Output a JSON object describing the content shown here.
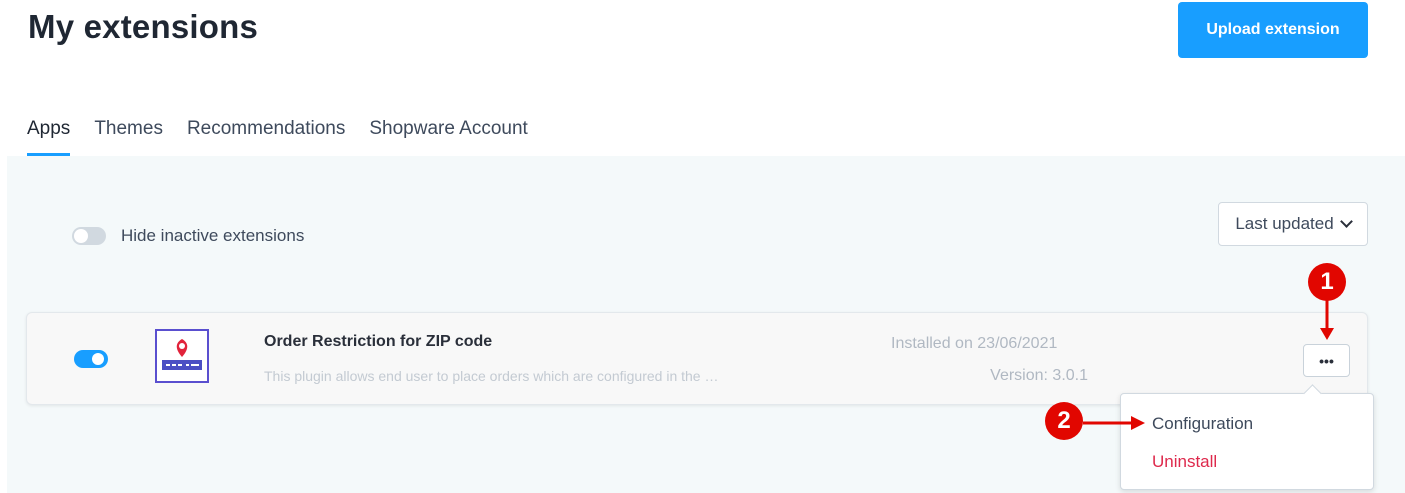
{
  "header": {
    "title": "My extensions",
    "upload_label": "Upload extension"
  },
  "tabs": [
    {
      "label": "Apps",
      "active": true
    },
    {
      "label": "Themes"
    },
    {
      "label": "Recommendations"
    },
    {
      "label": "Shopware Account"
    }
  ],
  "filters": {
    "hide_inactive_label": "Hide inactive extensions",
    "hide_inactive_on": false,
    "sort_label": "Last updated"
  },
  "extension": {
    "name": "Order Restriction for ZIP code",
    "description": "This plugin allows end user to place orders which are configured in the …",
    "installed": "Installed on 23/06/2021",
    "version": "Version: 3.0.1",
    "active": true,
    "more_label": "•••"
  },
  "context_menu": {
    "configuration": "Configuration",
    "uninstall": "Uninstall"
  },
  "annotations": {
    "marker_1": "1",
    "marker_2": "2"
  },
  "colors": {
    "accent": "#189eff",
    "danger": "#de294c",
    "annotation_red": "#e10600",
    "content_bg": "#f4f9fa"
  }
}
